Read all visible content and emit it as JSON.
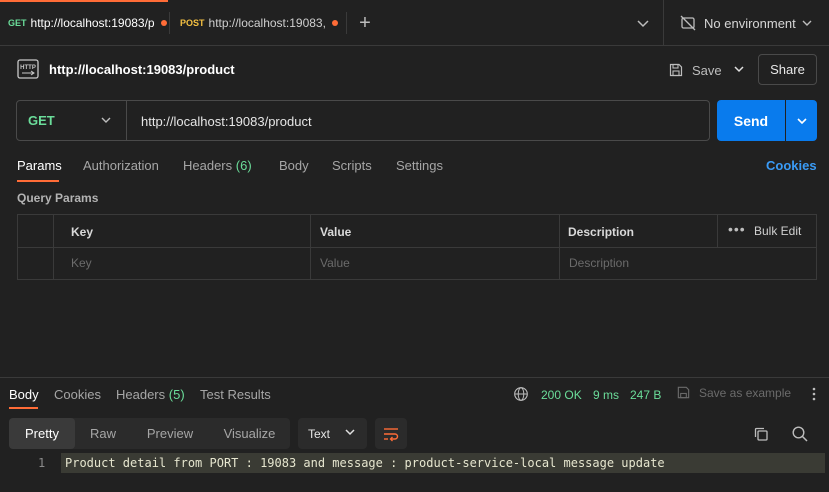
{
  "tabs": [
    {
      "method": "GET",
      "method_color": "#6bdd9a",
      "title": "http://localhost:19083/p",
      "unsaved": true
    },
    {
      "method": "POST",
      "method_color": "#f5c142",
      "title": "http://localhost:19083,",
      "unsaved": true
    }
  ],
  "environment": {
    "label": "No environment"
  },
  "request": {
    "title": "http://localhost:19083/product",
    "save_label": "Save",
    "share_label": "Share",
    "method": "GET",
    "url": "http://localhost:19083/product",
    "send_label": "Send",
    "tabs": {
      "params": "Params",
      "authorization": "Authorization",
      "headers": "Headers",
      "headers_count": "(6)",
      "body": "Body",
      "scripts": "Scripts",
      "settings": "Settings"
    },
    "cookies_label": "Cookies",
    "query_params_title": "Query Params",
    "params_table": {
      "headers": {
        "key": "Key",
        "value": "Value",
        "description": "Description",
        "bulk_edit": "Bulk Edit"
      },
      "placeholders": {
        "key": "Key",
        "value": "Value",
        "description": "Description"
      }
    }
  },
  "response": {
    "tabs": {
      "body": "Body",
      "cookies": "Cookies",
      "headers": "Headers",
      "headers_count": "(5)",
      "test_results": "Test Results"
    },
    "status": "200 OK",
    "time": "9 ms",
    "size": "247 B",
    "save_example_label": "Save as example",
    "view_modes": [
      "Pretty",
      "Raw",
      "Preview",
      "Visualize"
    ],
    "format": "Text",
    "lines": [
      {
        "number": "1",
        "text": "Product detail from PORT : 19083 and message : product-service-local message update"
      }
    ]
  },
  "colors": {
    "accent": "#ff6c37",
    "send": "#097bed",
    "success": "#6bdd9a",
    "link": "#3a9bf6"
  }
}
